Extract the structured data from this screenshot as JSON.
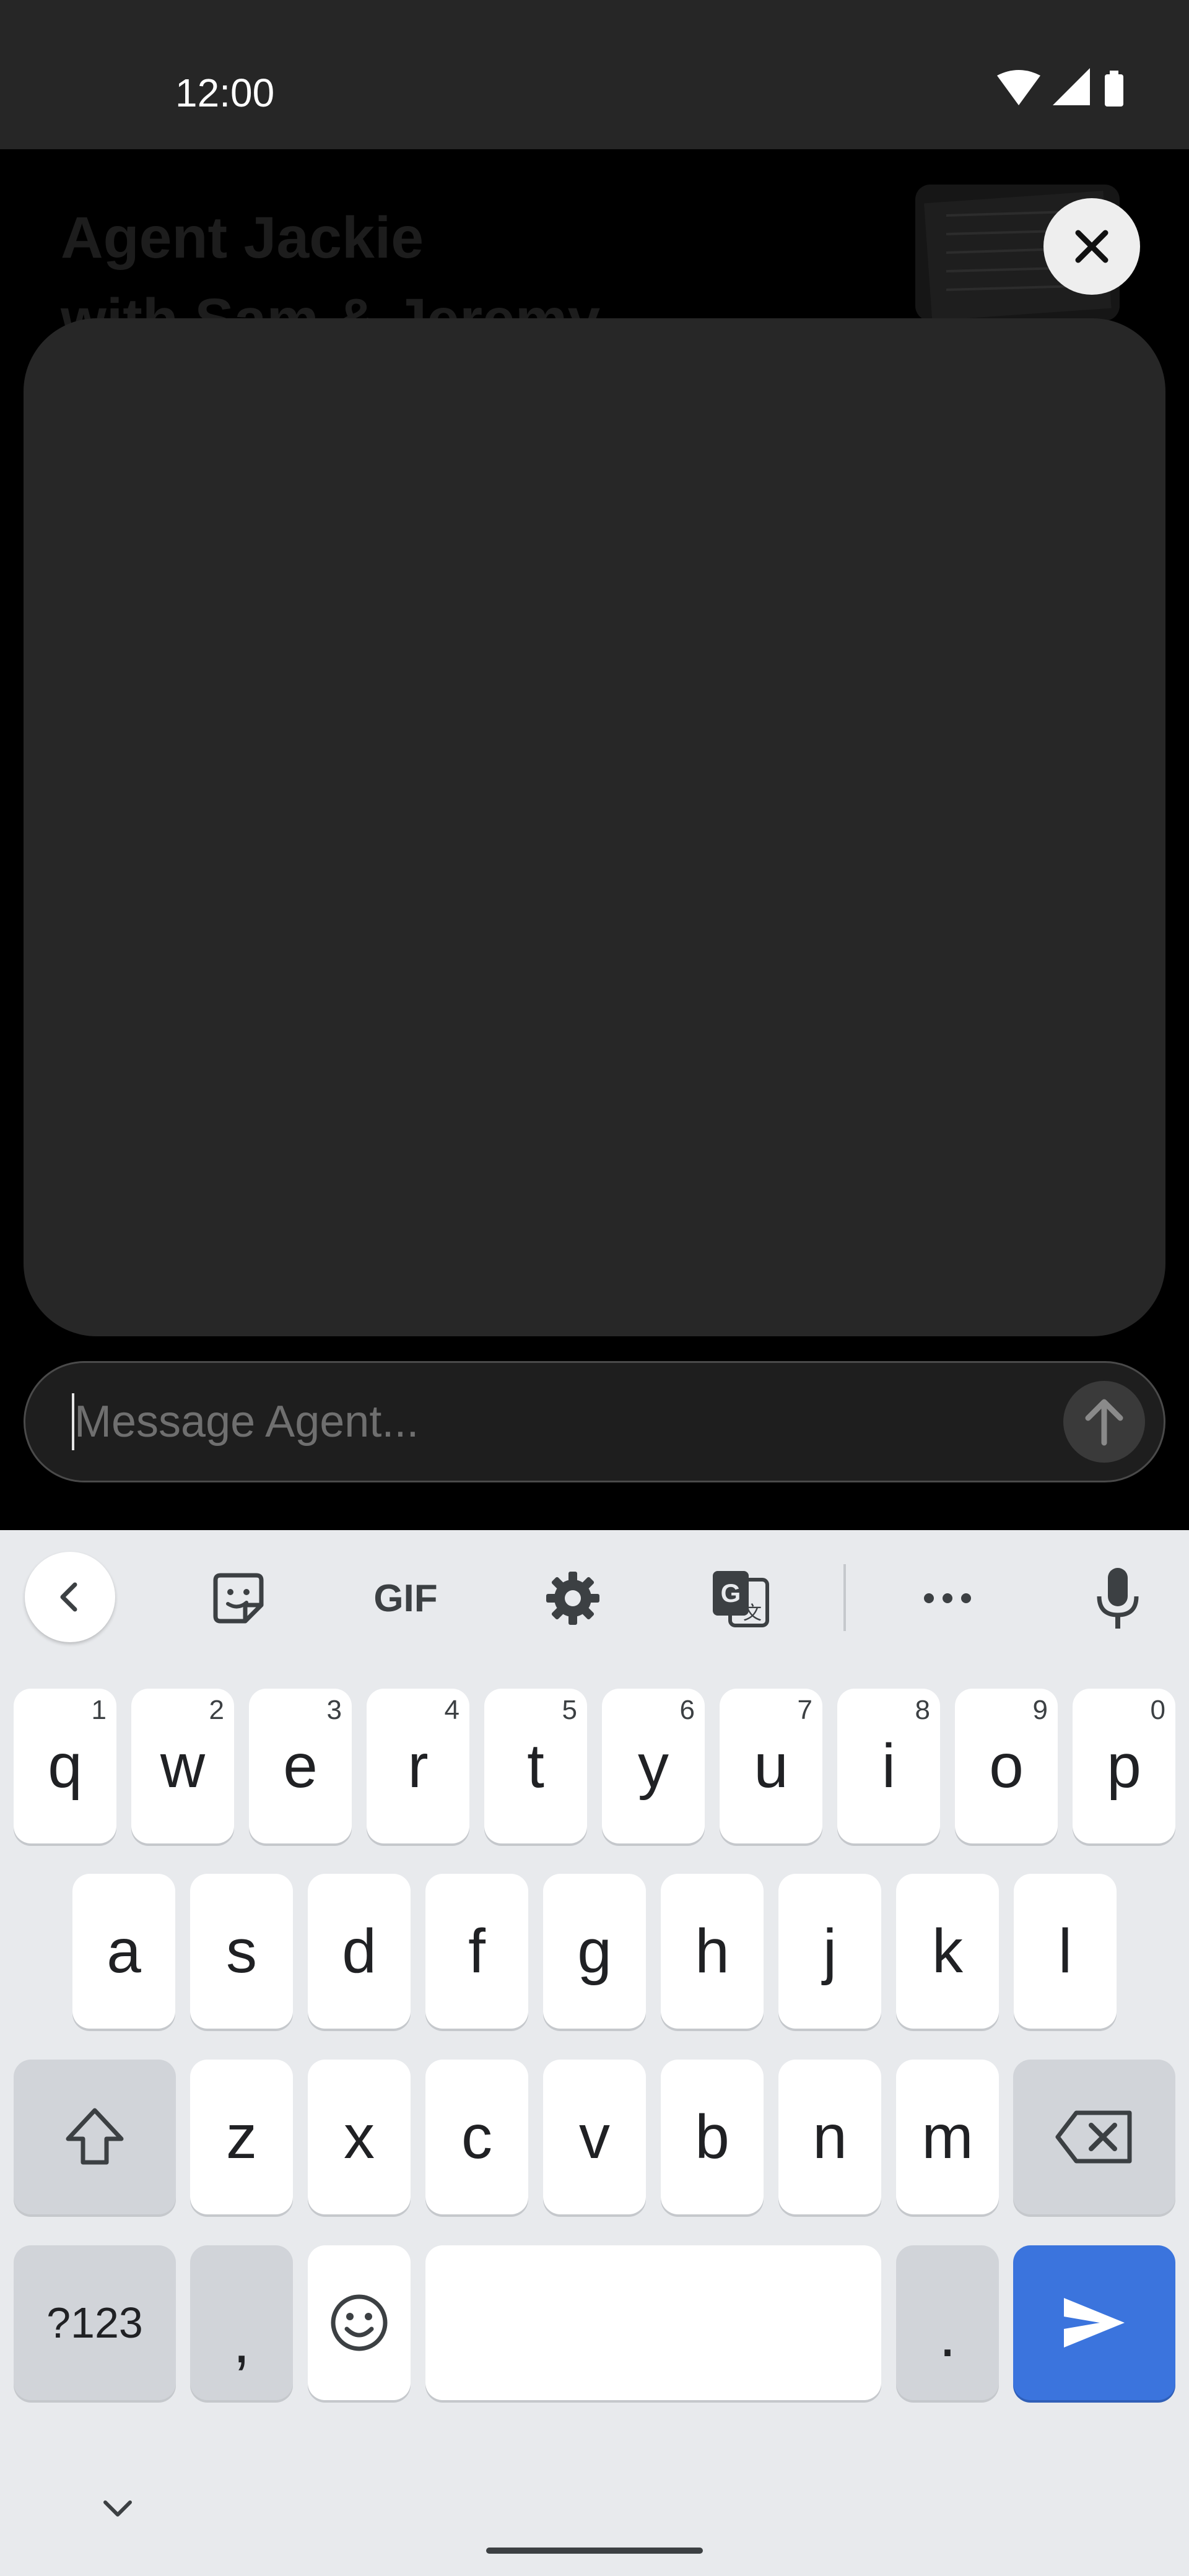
{
  "status_bar": {
    "time": "12:00"
  },
  "background": {
    "title": "Agent Jackie\nwith Sam & Jeremy"
  },
  "message": {
    "placeholder": "Message Agent..."
  },
  "keyboard": {
    "toolbar": {
      "gif_label": "GIF"
    },
    "row1": [
      {
        "label": "q",
        "hint": "1"
      },
      {
        "label": "w",
        "hint": "2"
      },
      {
        "label": "e",
        "hint": "3"
      },
      {
        "label": "r",
        "hint": "4"
      },
      {
        "label": "t",
        "hint": "5"
      },
      {
        "label": "y",
        "hint": "6"
      },
      {
        "label": "u",
        "hint": "7"
      },
      {
        "label": "i",
        "hint": "8"
      },
      {
        "label": "o",
        "hint": "9"
      },
      {
        "label": "p",
        "hint": "0"
      }
    ],
    "row2": [
      "a",
      "s",
      "d",
      "f",
      "g",
      "h",
      "j",
      "k",
      "l"
    ],
    "row3": [
      "z",
      "x",
      "c",
      "v",
      "b",
      "n",
      "m"
    ],
    "symbols_label": "?123",
    "comma_label": ",",
    "period_label": "."
  },
  "icons": {
    "close": "close-icon",
    "send": "arrow-up-icon",
    "back": "chevron-left-icon",
    "sticker": "sticker-icon",
    "settings": "gear-icon",
    "translate": "translate-icon",
    "more": "more-icon",
    "mic": "microphone-icon",
    "shift": "shift-icon",
    "backspace": "backspace-icon",
    "emoji": "emoji-icon",
    "enter": "send-icon",
    "collapse": "chevron-down-icon"
  },
  "colors": {
    "accent": "#3b74dd"
  }
}
